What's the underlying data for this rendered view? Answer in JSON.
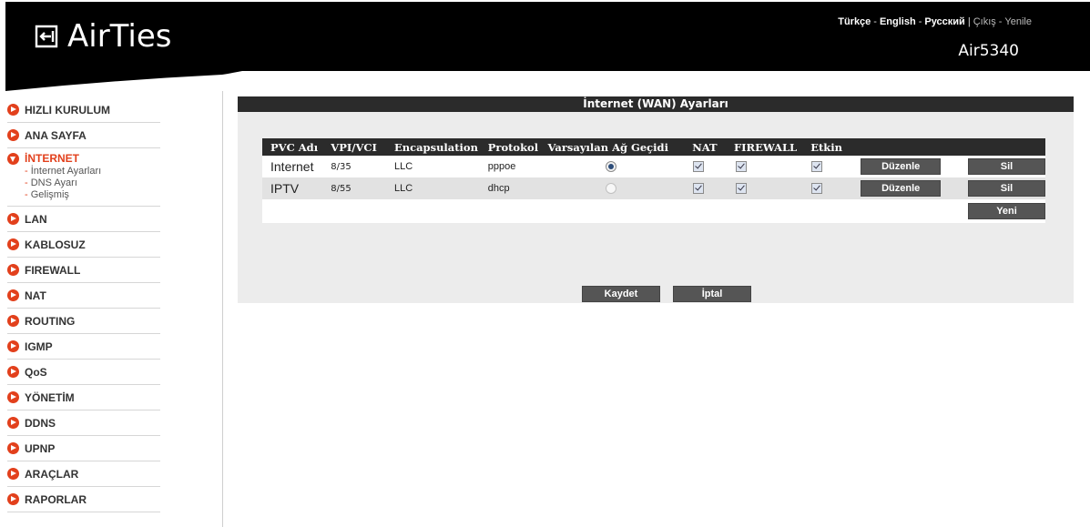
{
  "header": {
    "logo_text": "AirTies",
    "model": "Air5340",
    "links": {
      "turkce": "Türkçe",
      "english": "English",
      "russian": "Русский",
      "cikis": "Çıkış",
      "yenile": "Yenile",
      "dash": "-",
      "bar": "|"
    }
  },
  "sidebar": {
    "items": [
      {
        "label": "HIZLI KURULUM"
      },
      {
        "label": "ANA SAYFA"
      },
      {
        "label": "İNTERNET",
        "sub": [
          "İnternet Ayarları",
          "DNS Ayarı",
          "Gelişmiş"
        ]
      },
      {
        "label": "LAN"
      },
      {
        "label": "KABLOSUZ"
      },
      {
        "label": "FIREWALL"
      },
      {
        "label": "NAT"
      },
      {
        "label": "ROUTING"
      },
      {
        "label": "IGMP"
      },
      {
        "label": "QoS"
      },
      {
        "label": "YÖNETİM"
      },
      {
        "label": "DDNS"
      },
      {
        "label": "UPNP"
      },
      {
        "label": "ARAÇLAR"
      },
      {
        "label": "RAPORLAR"
      }
    ]
  },
  "main": {
    "title": "İnternet (WAN) Ayarları",
    "columns": [
      "PVC Adı",
      "VPI/VCI",
      "Encapsulation",
      "Protokol",
      "Varsayılan Ağ Geçidi",
      "NAT",
      "FIREWALL",
      "Etkin"
    ],
    "rows": [
      {
        "pvc": "Internet",
        "vpi": "8/35",
        "encap": "LLC",
        "proto": "pppoe",
        "default_gw": true,
        "nat": true,
        "firewall": true,
        "enabled": true
      },
      {
        "pvc": "IPTV",
        "vpi": "8/55",
        "encap": "LLC",
        "proto": "dhcp",
        "default_gw": false,
        "nat": true,
        "firewall": true,
        "enabled": true
      }
    ],
    "edit_label": "Düzenle",
    "delete_label": "Sil",
    "new_label": "Yeni",
    "save_label": "Kaydet",
    "cancel_label": "İptal"
  },
  "colors": {
    "accent": "#e2401c",
    "header_bg": "#000000",
    "button_bg": "#555555"
  }
}
